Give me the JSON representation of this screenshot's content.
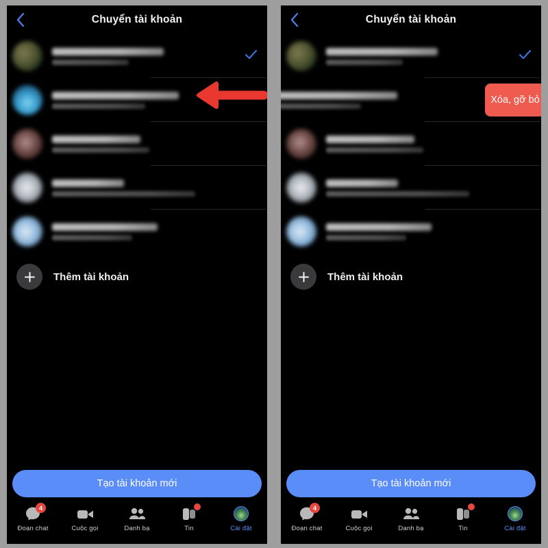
{
  "app": {
    "platform": "Messenger (dark mode)",
    "accent_blue": "#5b8df8",
    "danger_red": "#ef5b4f",
    "badge_red": "#e8473f"
  },
  "header": {
    "title": "Chuyển tài khoản",
    "back_icon": "chevron-left-icon"
  },
  "accounts": [
    {
      "selected": true,
      "checkmark": "check-icon",
      "name_redacted": true,
      "sub_redacted": true,
      "name_width": "58%",
      "sub_width": "40%"
    },
    {
      "selected": false,
      "checkmark": "",
      "name_redacted": true,
      "sub_redacted": true,
      "name_width": "60%",
      "sub_width": "44%"
    },
    {
      "selected": false,
      "checkmark": "",
      "name_redacted": true,
      "sub_redacted": true,
      "name_width": "42%",
      "sub_width": "46%"
    },
    {
      "selected": false,
      "checkmark": "",
      "name_redacted": true,
      "sub_redacted": true,
      "name_width": "34%",
      "sub_width": "68%"
    },
    {
      "selected": false,
      "checkmark": "",
      "name_redacted": true,
      "sub_redacted": true,
      "name_width": "50%",
      "sub_width": "38%"
    }
  ],
  "add_account": {
    "label": "Thêm tài khoản",
    "icon": "plus-icon"
  },
  "cta": {
    "label": "Tạo tài khoản mới"
  },
  "swipe_action": {
    "label": "Xóa, gỡ bỏ",
    "row_index": 2,
    "visible_on_panel": "right"
  },
  "annotation": {
    "arrow_icon": "left-arrow-icon",
    "color": "#e8382f",
    "points_at_row": 2,
    "visible_on_panel": "left"
  },
  "nav": {
    "items": [
      {
        "label": "Đoạn chat",
        "icon": "chat-bubble-icon",
        "badge": "4",
        "dot": false,
        "active": false
      },
      {
        "label": "Cuộc gọi",
        "icon": "video-camera-icon",
        "badge": "",
        "dot": false,
        "active": false
      },
      {
        "label": "Danh bạ",
        "icon": "people-icon",
        "badge": "",
        "dot": false,
        "active": false
      },
      {
        "label": "Tin",
        "icon": "stories-icon",
        "badge": "",
        "dot": true,
        "active": false
      },
      {
        "label": "Cài đặt",
        "icon": "avatar-icon",
        "badge": "",
        "dot": false,
        "active": true
      }
    ]
  },
  "panels": [
    {
      "id": "left",
      "state": "before-swipe"
    },
    {
      "id": "right",
      "state": "after-swipe"
    }
  ]
}
